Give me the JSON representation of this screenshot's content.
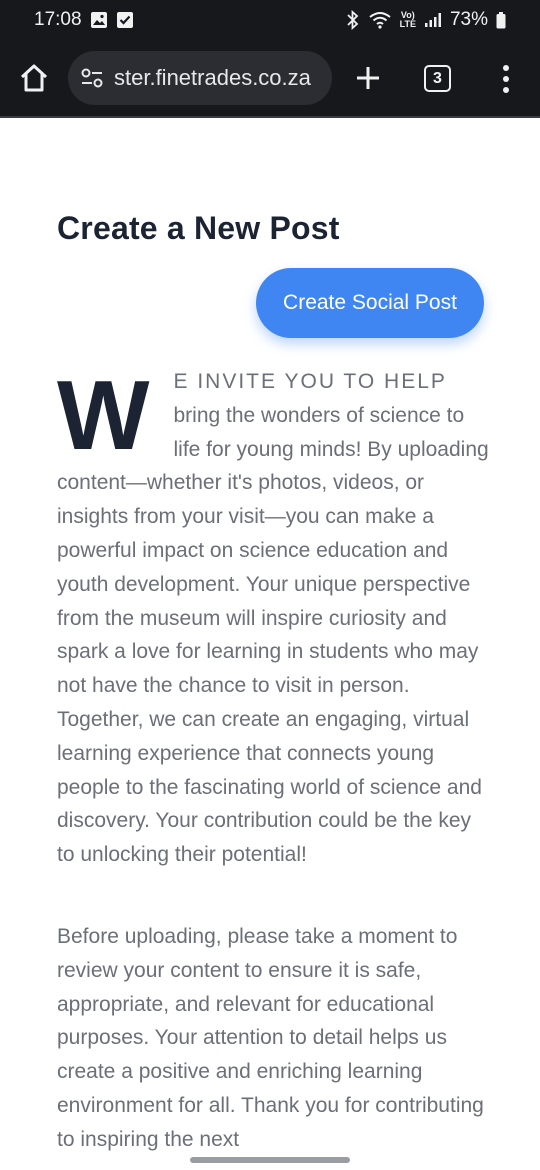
{
  "status_bar": {
    "time": "17:08",
    "battery": "73%",
    "net_label_top": "Vo)",
    "net_label_bottom": "LTE"
  },
  "browser": {
    "url": "ster.finetrades.co.za",
    "tab_count": "3"
  },
  "page": {
    "title": "Create a New Post",
    "create_button": "Create Social Post",
    "dropcap": "W",
    "intro_lead": "E INVITE YOU TO HELP",
    "intro_body": "bring the wonders of science to life for young minds! By uploading content—whether it's photos, videos, or insights from your visit—you can make a powerful impact on science education and youth development. Your unique perspective from the museum will inspire curiosity and spark a love for learning in students who may not have the chance to visit in person. Together, we can create an engaging, virtual learning experience that connects young people to the fascinating world of science and discovery. Your contribution could be the key to unlocking their potential!",
    "paragraph2": "Before uploading, please take a moment to review your content to ensure it is safe, appropriate, and relevant for educational purposes. Your attention to detail helps us create a positive and enriching learning environment for all. Thank you for contributing to inspiring the next"
  },
  "icons": {
    "home": "home-icon",
    "site_settings": "tune-icon",
    "new_tab": "plus-icon",
    "menu": "more-vert-icon"
  },
  "colors": {
    "accent": "#3f86f2",
    "title": "#1c2433",
    "body_text": "#6b6f78",
    "browser_bg": "#17181c"
  }
}
